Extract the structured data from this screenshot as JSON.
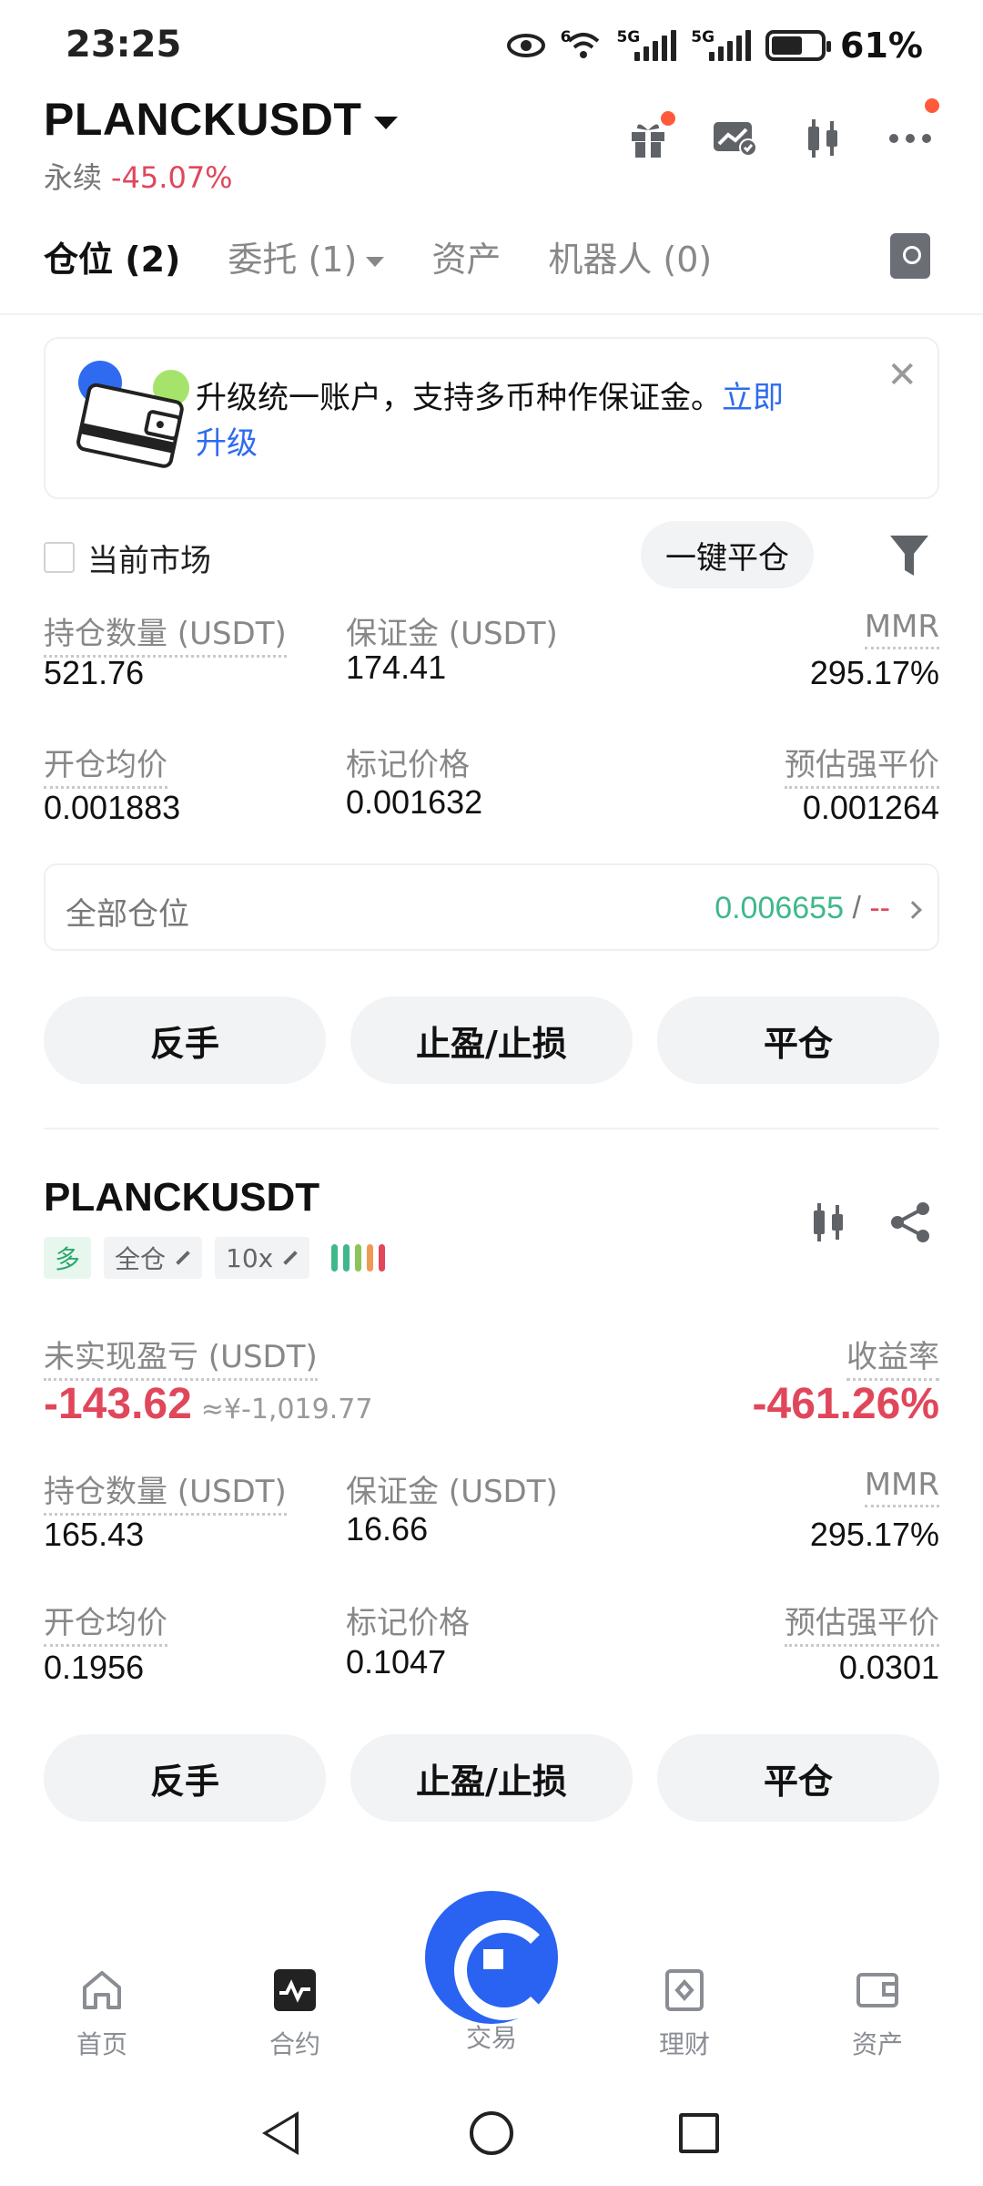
{
  "status_bar": {
    "time": "23:25",
    "net1": "6",
    "net2": "5G",
    "net3": "5G",
    "battery": "61%",
    "battery_level": 0.61
  },
  "header": {
    "symbol": "PLANCKUSDT",
    "type": "永续",
    "change": "-45.07%",
    "icons": [
      "gift-icon",
      "chart-check-icon",
      "candlestick-icon",
      "more-icon"
    ]
  },
  "tabs": [
    {
      "label": "仓位 (2)",
      "active": true
    },
    {
      "label": "委托 (1)",
      "active": false
    },
    {
      "label": "资产",
      "active": false
    },
    {
      "label": "机器人 (0)",
      "active": false
    }
  ],
  "banner": {
    "text": "升级统一账户，支持多币种作保证金。",
    "link_line1": "立即",
    "link_line2": "升级",
    "close": "✕"
  },
  "filter": {
    "current_market": "当前市场",
    "close_all": "一键平仓"
  },
  "summary": {
    "pos_qty_label": "持仓数量 (USDT)",
    "pos_qty": "521.76",
    "margin_label": "保证金 (USDT)",
    "margin": "174.41",
    "mmr_label": "MMR",
    "mmr": "295.17%",
    "entry_label": "开仓均价",
    "entry": "0.001883",
    "mark_label": "标记价格",
    "mark": "0.001632",
    "liq_label": "预估强平价",
    "liq": "0.001264",
    "all_positions_label": "全部仓位",
    "all_positions_val": "0.006655",
    "all_positions_sep": " / ",
    "all_positions_dash": "--"
  },
  "actions": {
    "reverse": "反手",
    "tpsl": "止盈/止损",
    "close": "平仓"
  },
  "position": {
    "symbol": "PLANCKUSDT",
    "side": "多",
    "margin_mode": "全仓",
    "leverage": "10x",
    "upnl_label": "未实现盈亏 (USDT)",
    "upnl": "-143.62",
    "upnl_cny": "≈¥-1,019.77",
    "roe_label": "收益率",
    "roe": "-461.26%",
    "pos_qty_label": "持仓数量 (USDT)",
    "pos_qty": "165.43",
    "margin_label": "保证金 (USDT)",
    "margin": "16.66",
    "mmr_label": "MMR",
    "mmr": "295.17%",
    "entry_label": "开仓均价",
    "entry": "0.1956",
    "mark_label": "标记价格",
    "mark": "0.1047",
    "liq_label": "预估强平价",
    "liq": "0.0301"
  },
  "bottom_nav": [
    {
      "label": "首页",
      "icon": "home-icon"
    },
    {
      "label": "合约",
      "icon": "futures-icon"
    },
    {
      "label": "交易",
      "icon": "trade-icon"
    },
    {
      "label": "理财",
      "icon": "finance-icon"
    },
    {
      "label": "资产",
      "icon": "wallet-icon"
    }
  ],
  "colors": {
    "red": "#e0475b",
    "green": "#3fb88b",
    "orange": "#ef9a52",
    "blue": "#2a63f2"
  }
}
